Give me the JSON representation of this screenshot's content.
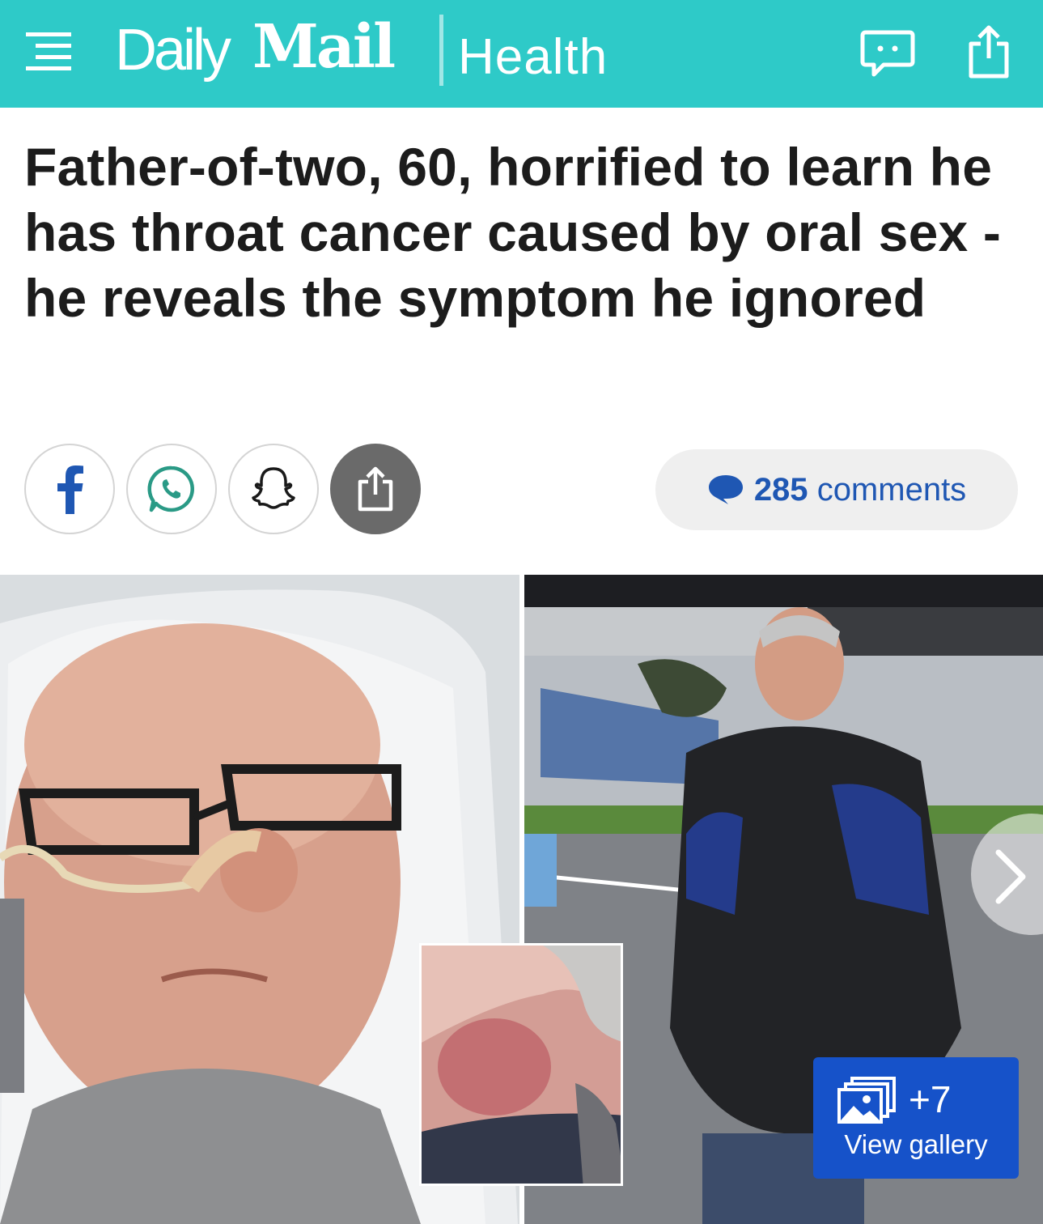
{
  "header": {
    "brand_left": "Daily",
    "brand_right": "Mail",
    "section": "Health",
    "background": "#2ecac8",
    "icons": [
      "menu-icon",
      "comment-bubble-icon",
      "share-icon"
    ]
  },
  "article": {
    "headline": "Father-of-two, 60, horrified to learn he has throat cancer caused by oral sex - he reveals the symptom he ignored"
  },
  "share": {
    "buttons": [
      {
        "icon": "facebook-icon"
      },
      {
        "icon": "whatsapp-icon"
      },
      {
        "icon": "snapchat-icon"
      },
      {
        "icon": "share-icon"
      }
    ],
    "comments_count": "285",
    "comments_label": "comments",
    "comments_color": "#1f57b3"
  },
  "gallery": {
    "extra_count": "+7",
    "label": "View gallery",
    "badge_color": "#1652c9"
  }
}
